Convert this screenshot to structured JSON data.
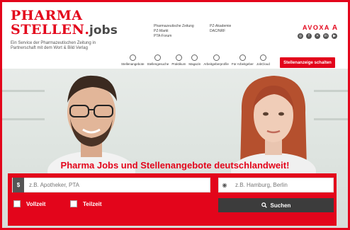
{
  "brand": {
    "line1": "PHARMA",
    "line2": "STELLEN",
    "dot": ".",
    "jobs": "jobs",
    "tagline": "Ein Service der Pharmazeutischen Zeitung in Partnerschaft mit dem Wort & Bild Verlag"
  },
  "toplinks": {
    "col1": [
      "Pharmazeutische Zeitung",
      "PZ-Markt",
      "PTA-Forum"
    ],
    "col2": [
      "PZ-Akademie",
      "DAC/NRF"
    ]
  },
  "publisher": {
    "name": "AVOXA",
    "mark": "A"
  },
  "social": [
    {
      "icon": "instagram-icon",
      "glyph": "◎"
    },
    {
      "icon": "facebook-icon",
      "glyph": "f"
    },
    {
      "icon": "x-icon",
      "glyph": "✕"
    },
    {
      "icon": "linkedin-icon",
      "glyph": "in"
    },
    {
      "icon": "youtube-icon",
      "glyph": "▶"
    }
  ],
  "nav": [
    {
      "label": "Stellenangebote",
      "icon": "briefcase-icon"
    },
    {
      "label": "Stellengesuche",
      "icon": "person-search-icon"
    },
    {
      "label": "Praktikum",
      "icon": "graduation-cap-icon"
    },
    {
      "label": "Magazin",
      "icon": "magazine-icon"
    },
    {
      "label": "Arbeitgeberprofile",
      "icon": "building-icon"
    },
    {
      "label": "Für Arbeitgeber",
      "icon": "users-icon"
    },
    {
      "label": "JobCloud",
      "icon": "cloud-icon"
    }
  ],
  "cta": "Stellenanzeige schalten",
  "hero": {
    "headline": "Pharma Jobs und Stellenangebote deutschlandweit!"
  },
  "search": {
    "what_placeholder": "z.B. Apotheker, PTA",
    "where_placeholder": "z.B. Hamburg, Berlin",
    "fulltime": "Vollzeit",
    "parttime": "Teilzeit",
    "button": "Suchen"
  },
  "colors": {
    "brand_red": "#e3051b",
    "dark": "#3c3c3c"
  }
}
